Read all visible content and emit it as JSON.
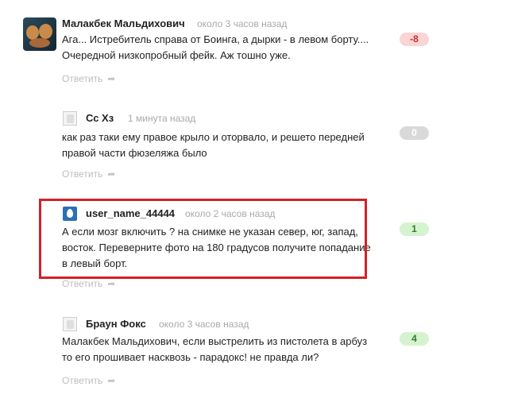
{
  "comments": [
    {
      "author": "Малакбек Мальдихович",
      "time": "около 3 часов назад",
      "text": "Ага... Истребитель справа от Боинга, а дырки - в левом борту.... Очередной низкопробный фейк. Аж тошно уже.",
      "reply": "Ответить",
      "rating": "-8",
      "avatar": "photo-avatar"
    },
    {
      "author": "Сс Хз",
      "time": "1 минута назад",
      "text": "как раз таки ему правое крыло и оторвало, и решето передней правой части фюзеляжа было",
      "reply": "Ответить",
      "rating": "0",
      "avatar": "default-avatar"
    },
    {
      "author": "user_name_44444",
      "time": "около 2 часов назад",
      "text": "А если мозг включить ? на снимке не указан север, юг, запад, восток. Переверните фото на 180 градусов получите попадание в левый борт.",
      "reply": "Ответить",
      "rating": "1",
      "avatar": "egg-avatar"
    },
    {
      "author": "Браун Фокс",
      "time": "около 3 часов назад",
      "text": "Малакбек Мальдихович, если выстрелить из пистолета в арбуз то его прошивает насквозь - парадокс! не правда ли?",
      "reply": "Ответить",
      "rating": "4",
      "avatar": "default-avatar"
    }
  ],
  "colors": {
    "highlight_border": "#d42027",
    "negative_badge_bg": "#fbd4d4",
    "neutral_badge_bg": "#d9d9d9",
    "positive_badge_bg": "#d5f3cf"
  }
}
